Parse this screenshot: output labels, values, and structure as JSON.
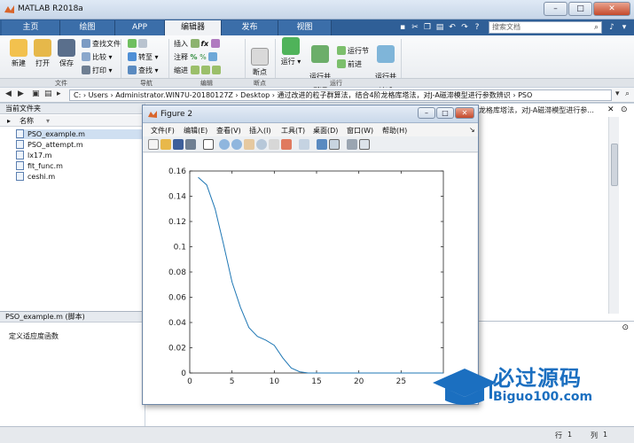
{
  "window": {
    "title": "MATLAB R2018a"
  },
  "tabs": [
    {
      "label": "主页"
    },
    {
      "label": "绘图"
    },
    {
      "label": "APP"
    },
    {
      "label": "编辑器"
    },
    {
      "label": "发布"
    },
    {
      "label": "视图"
    }
  ],
  "search": {
    "placeholder": "搜索文档"
  },
  "ribbon": {
    "file": {
      "new": "新建",
      "open": "打开",
      "save": "保存",
      "find_files": "查找文件",
      "compare": "比较",
      "print": "打印",
      "group": "文件"
    },
    "navigate": {
      "goto": "转至",
      "find": "查找",
      "group": "导航"
    },
    "edit": {
      "insert": "插入",
      "comment": "注释",
      "indent": "缩进",
      "fx": "fx",
      "group": "编辑"
    },
    "breakpoints": {
      "label": "断点",
      "group": "断点"
    },
    "run": {
      "run": "运行",
      "run_advance": "运行并\n前进",
      "run_section": "运行节",
      "advance": "前进",
      "run_time": "运行并\n计时",
      "group": "运行"
    }
  },
  "address": {
    "segments": "C: › Users › Administrator.WIN7U-20180127Z › Desktop › 通过改进的粒子群算法，结合4阶龙格库塔法，对J-A磁滞模型进行参数辨识 › PSO"
  },
  "current_folder": {
    "title": "当前文件夹",
    "column": "名称",
    "files": [
      {
        "name": "PSO_example.m",
        "selected": true
      },
      {
        "name": "PSO_attempt.m",
        "selected": false
      },
      {
        "name": "lx17.m",
        "selected": false
      },
      {
        "name": "fit_func.m",
        "selected": false
      },
      {
        "name": "ceshi.m",
        "selected": false
      }
    ]
  },
  "details": {
    "title": "PSO_example.m (脚本)",
    "text": "定义适应度函数"
  },
  "right_header": "龙格库塔法，对J-A磁滞模型进行参...",
  "status": {
    "row_label": "行",
    "row": "1",
    "col_label": "列",
    "col": "1"
  },
  "figure": {
    "title": "Figure 2",
    "menus": [
      "文件(F)",
      "编辑(E)",
      "查看(V)",
      "插入(I)",
      "工具(T)",
      "桌面(D)",
      "窗口(W)",
      "帮助(H)"
    ]
  },
  "chart_data": {
    "type": "line",
    "x": [
      1,
      2,
      3,
      4,
      5,
      6,
      7,
      8,
      9,
      10,
      11,
      12,
      13,
      14,
      15,
      16,
      17,
      18,
      19,
      20,
      21,
      22,
      23,
      24,
      25,
      26,
      27,
      28,
      29,
      30
    ],
    "series": [
      {
        "values": [
          0.155,
          0.149,
          0.13,
          0.102,
          0.072,
          0.052,
          0.036,
          0.029,
          0.026,
          0.022,
          0.012,
          0.004,
          0.001,
          0.0,
          0.0,
          0.0,
          0.0,
          0.0,
          0.0,
          0.0,
          0.0,
          0.0,
          0.0,
          0.0,
          0.0,
          0.0,
          0.0,
          0.0,
          0.0,
          0.0
        ]
      }
    ],
    "xlim": [
      0,
      30
    ],
    "ylim": [
      0,
      0.16
    ],
    "xticks": [
      "0",
      "5",
      "10",
      "15",
      "20",
      "25"
    ],
    "yticks": [
      "0",
      "0.02",
      "0.04",
      "0.06",
      "0.08",
      "0.1",
      "0.12",
      "0.14",
      "0.16"
    ],
    "line_color": "#1f77b4",
    "grid": false
  },
  "watermark": {
    "text": "必过源码",
    "url": "Biguo100.com",
    "color": "#1b6fc0"
  }
}
